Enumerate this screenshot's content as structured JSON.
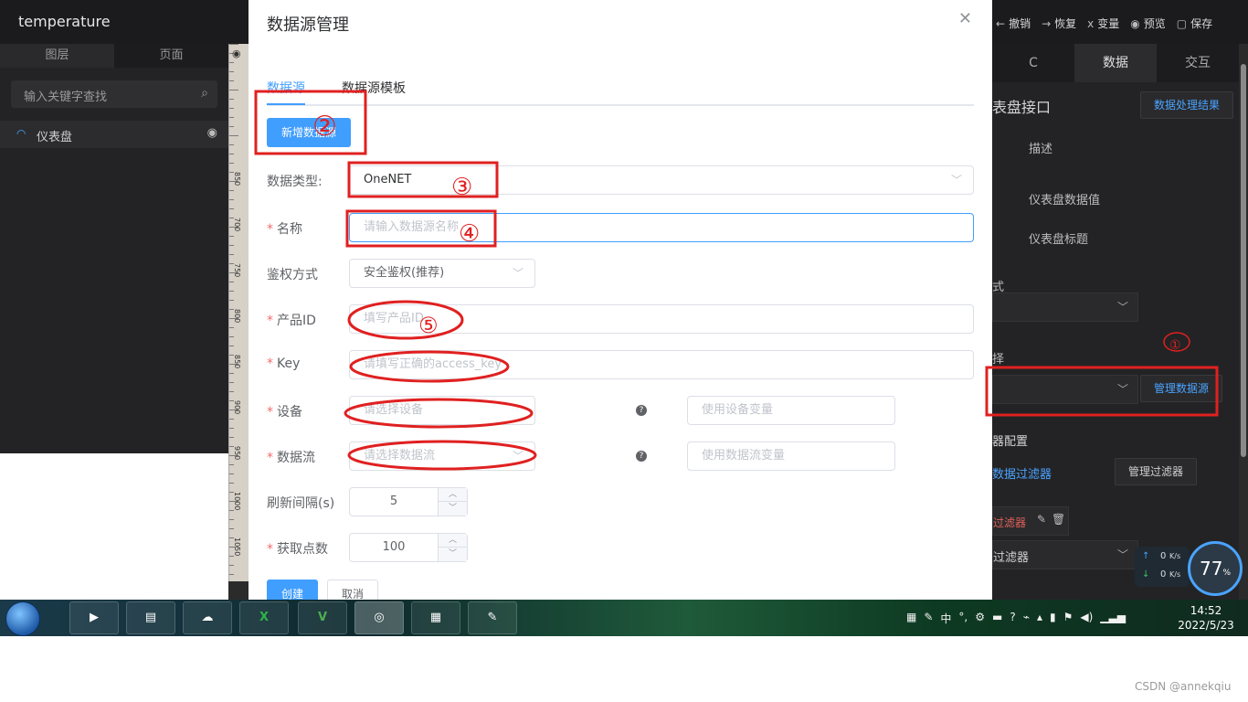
{
  "app": {
    "title": "temperature"
  },
  "toolbar": {
    "undo": "撤销",
    "redo": "恢复",
    "variable": "变量",
    "preview": "预览",
    "save": "保存",
    "variable_symbol": "x"
  },
  "left_panel": {
    "tabs": [
      "图层",
      "页面"
    ],
    "search_placeholder": "输入关键字查找",
    "layer_item": "仪表盘"
  },
  "right_panel": {
    "tabs": [
      "C",
      "数据",
      "交互"
    ],
    "section_title": "表盘接口",
    "data_result_button": "数据处理结果",
    "desc_header": "描述",
    "desc_rows": [
      "仪表盘数据值",
      "仪表盘标题"
    ],
    "mode_label": "式",
    "select_label": "择",
    "manage_datasource_button": "管理数据源",
    "filter_config_label": "器配置",
    "data_filter_link": "数据过滤器",
    "manage_filter_button": "管理过滤器",
    "filter_item": "过滤器",
    "filter_select": "过滤器"
  },
  "net_widget": {
    "upload": "0",
    "download": "0",
    "unit": "K/s",
    "percent": "77",
    "percent_symbol": "%"
  },
  "modal": {
    "title": "数据源管理",
    "tabs": [
      "数据源",
      "数据源模板"
    ],
    "new_button": "新增数据源",
    "fields": {
      "data_type": {
        "label": "数据类型:",
        "value": "OneNET"
      },
      "name": {
        "label": "名称",
        "placeholder": "请输入数据源名称",
        "required": true
      },
      "auth": {
        "label": "鉴权方式",
        "value": "安全鉴权(推荐)"
      },
      "product_id": {
        "label": "产品ID",
        "placeholder": "填写产品ID",
        "required": true
      },
      "key": {
        "label": "Key",
        "placeholder": "请填写正确的access_key",
        "required": true
      },
      "device": {
        "label": "设备",
        "placeholder": "请选择设备",
        "variable_placeholder": "使用设备变量",
        "required": true
      },
      "datastream": {
        "label": "数据流",
        "placeholder": "请选择数据流",
        "variable_placeholder": "使用数据流变量",
        "required": true
      },
      "refresh": {
        "label": "刷新间隔(s)",
        "value": "5"
      },
      "points": {
        "label": "获取点数",
        "value": "100",
        "required": true
      }
    },
    "create_button": "创建",
    "cancel_button": "取消"
  },
  "annotations": [
    "①",
    "②",
    "③",
    "④",
    "⑤"
  ],
  "taskbar": {
    "apps": [
      "media-player",
      "file-explorer",
      "baidu-netdisk",
      "excel",
      "vs-code",
      "chrome",
      "office-app",
      "paint"
    ],
    "tray_ime": "中",
    "time": "14:52",
    "date": "2022/5/23"
  },
  "watermark": "CSDN @annekqiu",
  "ruler_labels": [
    "850",
    "700",
    "750",
    "800",
    "850",
    "900",
    "950",
    "1000",
    "1050",
    "1100"
  ],
  "colors": {
    "accent": "#409eff",
    "annotation": "#e02020",
    "dark_bg": "#232325"
  }
}
